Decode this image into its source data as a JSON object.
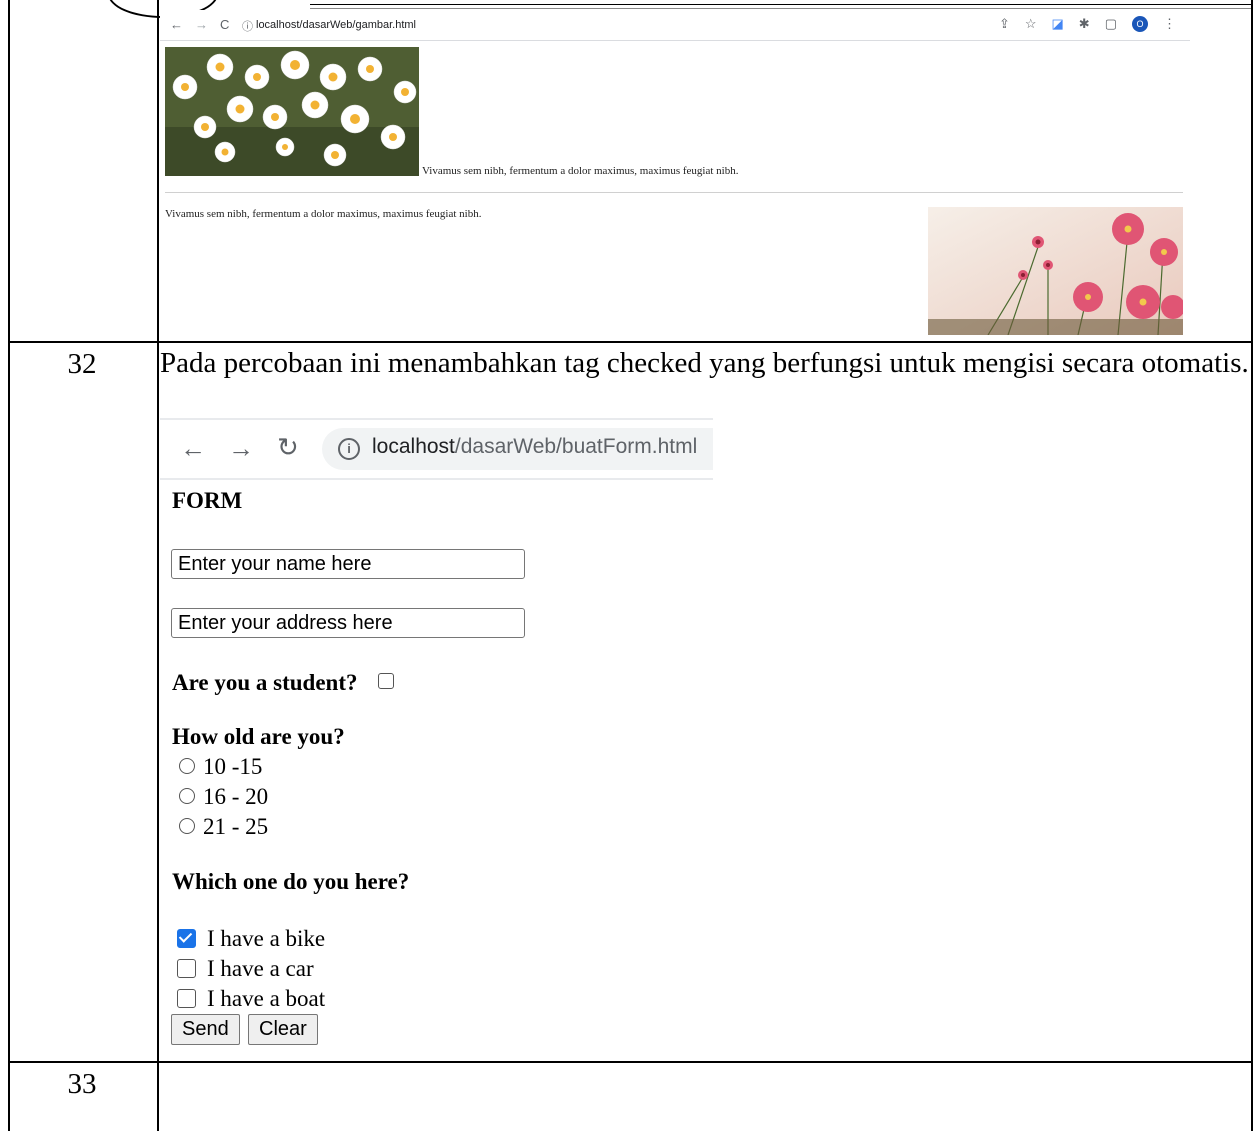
{
  "rows": [
    {
      "number": "32"
    },
    {
      "number": "33"
    }
  ],
  "screenshot1": {
    "url": "localhost/dasarWeb/gambar.html",
    "caption1": "Vivamus sem nibh, fermentum a dolor maximus, maximus feugiat nibh.",
    "caption2": "Vivamus sem nibh, fermentum a dolor maximus, maximus feugiat nibh.",
    "avatar_letter": "O"
  },
  "paragraph": "Pada percobaan ini menambahkan tag checked yang berfungsi untuk mengisi secara otomatis.",
  "screenshot2": {
    "url_host": "localhost",
    "url_path": "/dasarWeb/buatForm.html"
  },
  "form": {
    "title": "FORM",
    "name_placeholder": "Enter your name here",
    "address_placeholder": "Enter your address here",
    "student_question": "Are you a student?",
    "age_question": "How old are you?",
    "age_options": [
      "10 -15",
      "16 - 20",
      "21 - 25"
    ],
    "vehicle_question": "Which one do you here?",
    "vehicle_options": [
      {
        "label": "I have a bike",
        "checked": true
      },
      {
        "label": "I have a car",
        "checked": false
      },
      {
        "label": "I have a boat",
        "checked": false
      }
    ],
    "send_label": "Send",
    "clear_label": "Clear"
  },
  "colors": {
    "checkbox_accent": "#1a73e8",
    "avatar": "#1a56b8"
  }
}
